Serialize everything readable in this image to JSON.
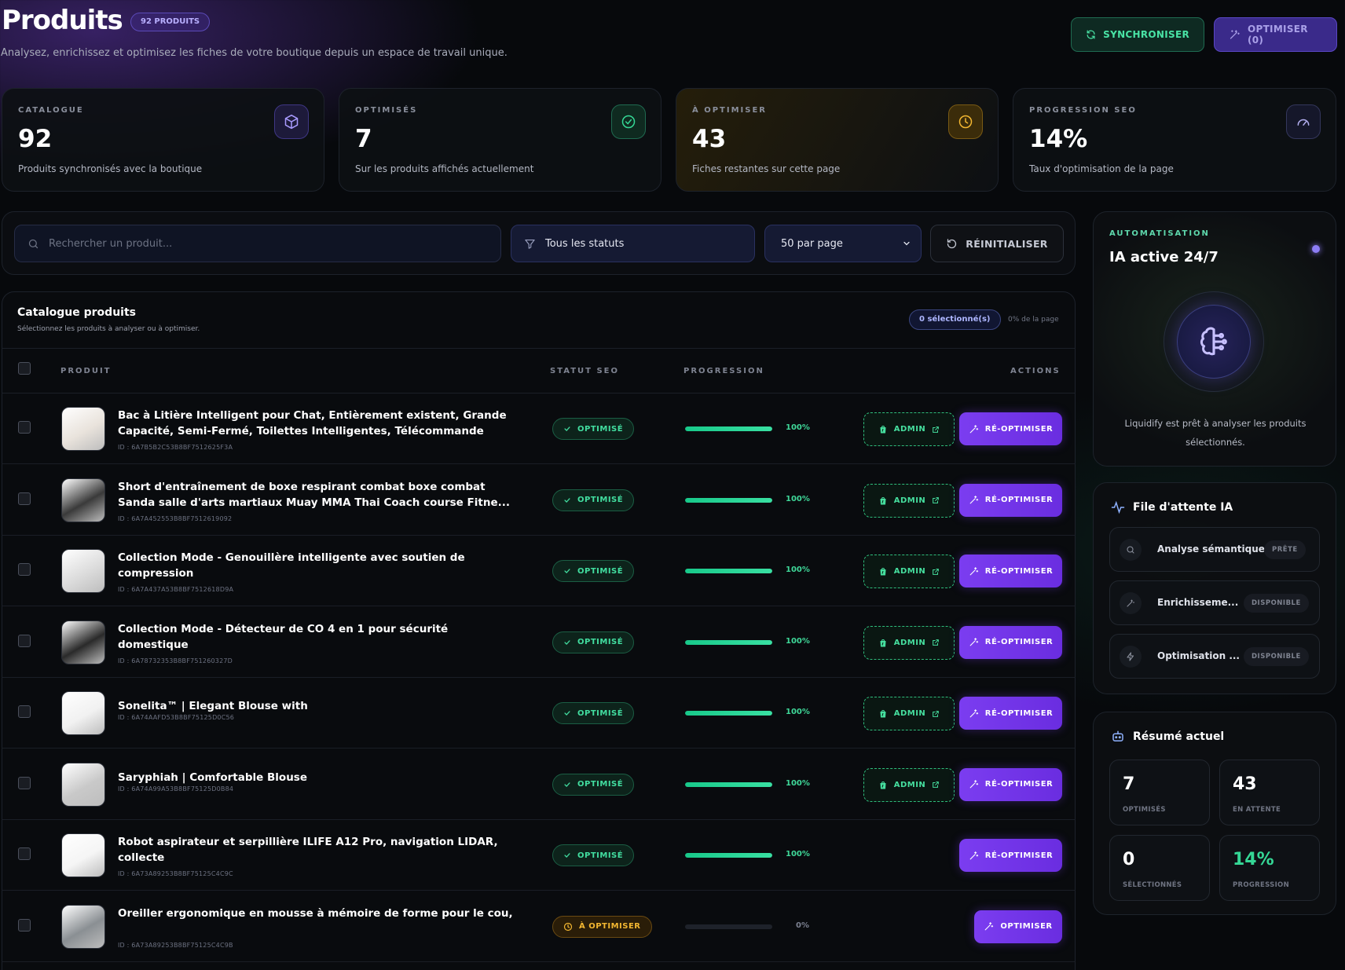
{
  "header": {
    "title": "Produits",
    "count_badge": "92 PRODUITS",
    "subtitle": "Analysez, enrichissez et optimisez les fiches de votre boutique depuis un espace de travail unique.",
    "sync_label": "SYNCHRONISER",
    "optimize_label": "OPTIMISER (0)"
  },
  "stats": [
    {
      "label": "CATALOGUE",
      "value": "92",
      "caption": "Produits synchronisés avec la boutique",
      "icon": "box-icon",
      "color": "#8f7cf6"
    },
    {
      "label": "OPTIMISÉS",
      "value": "7",
      "caption": "Sur les produits affichés actuellement",
      "icon": "check-circle-icon",
      "color": "#35d896"
    },
    {
      "label": "À OPTIMISER",
      "value": "43",
      "caption": "Fiches restantes sur cette page",
      "icon": "clock-icon",
      "color": "#f3b731"
    },
    {
      "label": "PROGRESSION SEO",
      "value": "14%",
      "caption": "Taux d'optimisation de la page",
      "icon": "gauge-icon",
      "color": "#a7a2e8"
    }
  ],
  "filters": {
    "search_placeholder": "Rechercher un produit...",
    "status": "Tous les statuts",
    "per_page": "50 par page",
    "reset_label": "RÉINITIALISER"
  },
  "catalog": {
    "title": "Catalogue produits",
    "subtitle": "Sélectionnez les produits à analyser ou à optimiser.",
    "selected": "0 sélectionné(s)",
    "page_pct": "0% de la page",
    "columns": {
      "product": "PRODUIT",
      "seo": "STATUT SEO",
      "progress": "PROGRESSION",
      "actions": "ACTIONS"
    },
    "admin_label": "ADMIN",
    "reoptimize_label": "RÉ-OPTIMISER",
    "optimize_label": "OPTIMISER",
    "rows": [
      {
        "name": "Bac à Litière Intelligent pour Chat, Entièrement existent, Grande Capacité, Semi-Fermé, Toilettes Intelligentes, Télécommande",
        "id": "ID : 6A7B5B2C53B8BF7512625F3A",
        "status": "OPTIMISÉ",
        "progress": 100,
        "progress_label": "100%",
        "admin": true,
        "action": "reopt",
        "thumb": "#e9e3dc"
      },
      {
        "name": "Short d'entraînement de boxe respirant combat boxe combat Sanda salle d'arts martiaux Muay MMA Thai Coach course Fitne...",
        "id": "ID : 6A7A452553B8BF7512619092",
        "status": "OPTIMISÉ",
        "progress": 100,
        "progress_label": "100%",
        "admin": true,
        "action": "reopt",
        "thumb": "#3a3a3a"
      },
      {
        "name": "Collection Mode - Genouillère intelligente avec soutien de compression",
        "id": "ID : 6A7A437A53B8BF7512618D9A",
        "status": "OPTIMISÉ",
        "progress": 100,
        "progress_label": "100%",
        "admin": true,
        "action": "reopt",
        "thumb": "#dcdcdc"
      },
      {
        "name": "Collection Mode - Détecteur de CO 4 en 1 pour sécurité domestique",
        "id": "ID : 6A78732353B8BF751260327D",
        "status": "OPTIMISÉ",
        "progress": 100,
        "progress_label": "100%",
        "admin": true,
        "action": "reopt",
        "thumb": "#2a2a2a"
      },
      {
        "name": "Sonelita™ | Elegant Blouse with",
        "id": "ID : 6A74AAFD53B8BF75125D0C56",
        "status": "OPTIMISÉ",
        "progress": 100,
        "progress_label": "100%",
        "admin": true,
        "action": "reopt",
        "thumb": "#f1f1f1"
      },
      {
        "name": "Saryphiah | Comfortable Blouse",
        "id": "ID : 6A74A99A53B8BF75125D0B84",
        "status": "OPTIMISÉ",
        "progress": 100,
        "progress_label": "100%",
        "admin": true,
        "action": "reopt",
        "thumb": "#c9c9c9"
      },
      {
        "name": "Robot aspirateur et serpillière ILIFE A12 Pro, navigation LIDAR, collecte",
        "id": "ID : 6A73A89253B8BF75125C4C9C",
        "status": "OPTIMISÉ",
        "progress": 100,
        "progress_label": "100%",
        "admin": false,
        "action": "reopt",
        "thumb": "#f5f5f5"
      },
      {
        "name": "Oreiller ergonomique en mousse à mémoire de forme pour le cou,",
        "id": "ID : 6A73A89253B8BF75125C4C9B",
        "status": "À OPTIMISER",
        "progress": 0,
        "progress_label": "0%",
        "admin": false,
        "action": "opt",
        "thumb": "#8a8f93"
      }
    ]
  },
  "automation": {
    "label": "AUTOMATISATION",
    "title": "IA active 24/7",
    "description": "Liquidify est prêt à analyser les produits sélectionnés."
  },
  "queue": {
    "title": "File d'attente IA",
    "items": [
      {
        "label": "Analyse sémantique",
        "badge": "PRÊTE",
        "icon": "search-icon"
      },
      {
        "label": "Enrichisseme...",
        "badge": "DISPONIBLE",
        "icon": "magic-wand-icon"
      },
      {
        "label": "Optimisation ...",
        "badge": "DISPONIBLE",
        "icon": "bolt-icon"
      }
    ]
  },
  "summary": {
    "title": "Résumé actuel",
    "tiles": [
      {
        "value": "7",
        "label": "OPTIMISÉS"
      },
      {
        "value": "43",
        "label": "EN ATTENTE"
      },
      {
        "value": "0",
        "label": "SÉLECTIONNÉS"
      },
      {
        "value": "14%",
        "label": "PROGRESSION"
      }
    ]
  }
}
